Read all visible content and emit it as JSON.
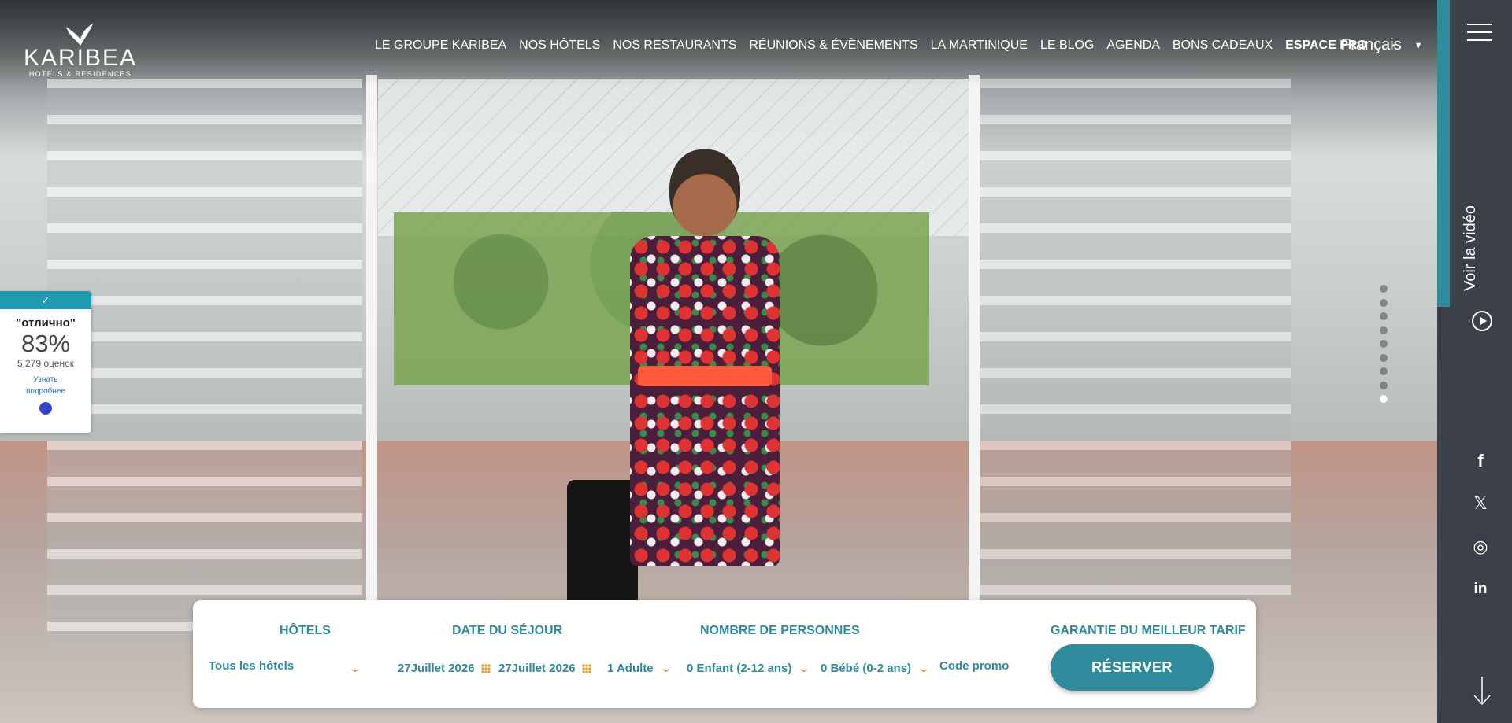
{
  "brand": {
    "name": "KARIBEA",
    "tagline": "HOTELS & RESIDENCES"
  },
  "nav": {
    "items": [
      {
        "label": "LE GROUPE KARIBEA"
      },
      {
        "label": "NOS HÔTELS"
      },
      {
        "label": "NOS RESTAURANTS"
      },
      {
        "label": "RÉUNIONS & ÉVÈNEMENTS"
      },
      {
        "label": "LA MARTINIQUE"
      },
      {
        "label": "LE BLOG"
      },
      {
        "label": "AGENDA"
      },
      {
        "label": "BONS CADEAUX"
      },
      {
        "label": "ESPACE PRO"
      }
    ],
    "separator": "•",
    "language": "Français"
  },
  "sidebar": {
    "video_label": "Voir la vidéo",
    "social": [
      {
        "icon": "facebook-icon",
        "glyph": "f"
      },
      {
        "icon": "x-twitter-icon",
        "glyph": "𝕏"
      },
      {
        "icon": "instagram-icon",
        "glyph": "◎"
      },
      {
        "icon": "linkedin-icon",
        "glyph": "in"
      }
    ]
  },
  "rating_widget": {
    "check": "✓",
    "word": "\"отлично\"",
    "percent": "83%",
    "reviews": "5,279 оценок",
    "more_line1": "Узнать",
    "more_line2": "подробнее"
  },
  "slider": {
    "count": 9,
    "active_index": 8
  },
  "booking": {
    "hotels_header": "HÔTELS",
    "hotels_value": "Tous les hôtels",
    "dates_header": "DATE DU SÉJOUR",
    "date_from": "27Juillet 2026",
    "date_to": "27Juillet 2026",
    "people_header": "NOMBRE DE PERSONNES",
    "adults": "1 Adulte",
    "children": "0 Enfant (2-12 ans)",
    "babies": "0 Bébé (0-2 ans)",
    "promo": "Code promo",
    "guarantee": "GARANTIE DU MEILLEUR TARIF",
    "reserve_label": "RÉSERVER"
  },
  "colors": {
    "accent": "#2f8a9c",
    "chevron": "#e4a43a",
    "sidebar": "#3c4049"
  }
}
